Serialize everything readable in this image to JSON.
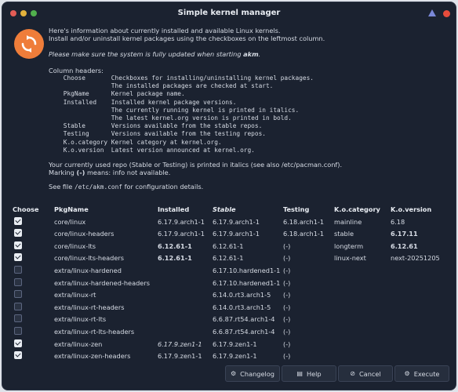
{
  "window": {
    "title": "Simple kernel manager"
  },
  "intro": {
    "line1": "Here's information about currently installed and available Linux kernels.",
    "line2": "Install and/or uninstall kernel packages using the checkboxes on the leftmost column.",
    "note_prefix": "Please make sure the system is fully updated when starting ",
    "note_bold": "akm",
    "note_suffix": "."
  },
  "column_help": {
    "heading": "Column headers:",
    "lines": [
      "    Choose       Checkboxes for installing/uninstalling kernel packages.",
      "                 The installed packages are checked at start.",
      "    PkgName      Kernel package name.",
      "    Installed    Installed kernel package versions.",
      "                 The currently running kernel is printed in italics.",
      "                 The latest kernel.org version is printed in bold.",
      "    Stable       Versions available from the stable repos.",
      "    Testing      Versions available from the testing repos.",
      "    K.o.category Kernel category at kernel.org.",
      "    K.o.version  Latest version announced at kernel.org."
    ]
  },
  "repo_note": {
    "line1": "Your currently used repo (Stable or Testing) is printed in italics (see also /etc/pacman.conf).",
    "line2_prefix": "Marking ",
    "line2_bold": "(-)",
    "line2_suffix": " means: info not available.",
    "config_prefix": "See file ",
    "config_file": "/etc/akm.conf",
    "config_suffix": " for configuration details."
  },
  "table": {
    "headers": {
      "choose": "Choose",
      "pkgname": "PkgName",
      "installed": "Installed",
      "stable": "Stable",
      "testing": "Testing",
      "category": "K.o.category",
      "version": "K.o.version"
    },
    "rows": [
      {
        "checked": true,
        "pkg": "core/linux",
        "installed": "6.17.9.arch1-1",
        "stable": "6.17.9.arch1-1",
        "testing": "6.18.arch1-1",
        "category": "mainline",
        "version": "6.18"
      },
      {
        "checked": true,
        "pkg": "core/linux-headers",
        "installed": "6.17.9.arch1-1",
        "stable": "6.17.9.arch1-1",
        "testing": "6.18.arch1-1",
        "category": "stable",
        "version": "6.17.11"
      },
      {
        "checked": true,
        "pkg": "core/linux-lts",
        "installed": "6.12.61-1",
        "stable": "6.12.61-1",
        "testing": "(-)",
        "category": "longterm",
        "version": "6.12.61"
      },
      {
        "checked": true,
        "pkg": "core/linux-lts-headers",
        "installed": "6.12.61-1",
        "stable": "6.12.61-1",
        "testing": "(-)",
        "category": "linux-next",
        "version": "next-20251205"
      },
      {
        "checked": false,
        "pkg": "extra/linux-hardened",
        "installed": "",
        "stable": "6.17.10.hardened1-1",
        "testing": "(-)",
        "category": "",
        "version": ""
      },
      {
        "checked": false,
        "pkg": "extra/linux-hardened-headers",
        "installed": "",
        "stable": "6.17.10.hardened1-1",
        "testing": "(-)",
        "category": "",
        "version": ""
      },
      {
        "checked": false,
        "pkg": "extra/linux-rt",
        "installed": "",
        "stable": "6.14.0.rt3.arch1-5",
        "testing": "(-)",
        "category": "",
        "version": ""
      },
      {
        "checked": false,
        "pkg": "extra/linux-rt-headers",
        "installed": "",
        "stable": "6.14.0.rt3.arch1-5",
        "testing": "(-)",
        "category": "",
        "version": ""
      },
      {
        "checked": false,
        "pkg": "extra/linux-rt-lts",
        "installed": "",
        "stable": "6.6.87.rt54.arch1-4",
        "testing": "(-)",
        "category": "",
        "version": ""
      },
      {
        "checked": false,
        "pkg": "extra/linux-rt-lts-headers",
        "installed": "",
        "stable": "6.6.87.rt54.arch1-4",
        "testing": "(-)",
        "category": "",
        "version": ""
      },
      {
        "checked": true,
        "pkg": "extra/linux-zen",
        "installed": "6.17.9.zen1-1",
        "stable": "6.17.9.zen1-1",
        "testing": "(-)",
        "category": "",
        "version": ""
      },
      {
        "checked": true,
        "pkg": "extra/linux-zen-headers",
        "installed": "6.17.9.zen1-1",
        "stable": "6.17.9.zen1-1",
        "testing": "(-)",
        "category": "",
        "version": ""
      }
    ]
  },
  "buttons": {
    "changelog": "Changelog",
    "help": "Help",
    "cancel": "Cancel",
    "execute": "Execute"
  },
  "colors": {
    "background": "#1b2230",
    "app_icon": "#ef7d3a",
    "text": "#d6dbe4"
  }
}
